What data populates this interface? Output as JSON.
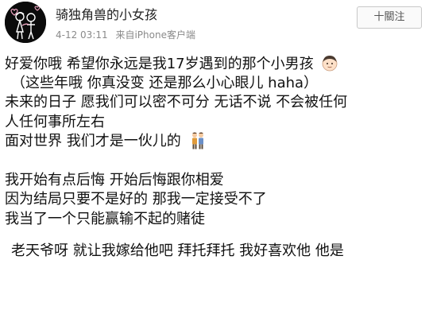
{
  "post": {
    "author_name": "骑独角兽的小女孩",
    "date": "4-12 03:11",
    "source": "来自iPhone客户端",
    "follow_label": "十關注"
  },
  "content": {
    "line1": "好爱你哦 希望你永远是我17岁遇到的那个小男孩",
    "line2": "（这些年哦 你真没变 还是那么小心眼儿 haha）",
    "line3": "未来的日子 愿我们可以密不可分 无话不说 不会被任何",
    "line4": "人任何事所左右",
    "line5": "面对世界  我们才是一伙儿的",
    "line6": "我开始有点后悔 开始后悔跟你相爱",
    "line7": "因为结局只要不是好的 那我一定接受不了",
    "line8": "我当了一个只能赢输不起的赌徒",
    "line9": "老天爷呀 就让我嫁给他吧 拜托拜托 我好喜欢他 他是"
  },
  "icons": {
    "avatar": "couple-illustration-avatar",
    "emoji1": "boy-face-emoji",
    "emoji2": "couple-emoji"
  },
  "colors": {
    "meta_text": "#8a8a8a",
    "follow_border": "#c8c8c8",
    "avatar_bg": "#0b0b0b"
  }
}
